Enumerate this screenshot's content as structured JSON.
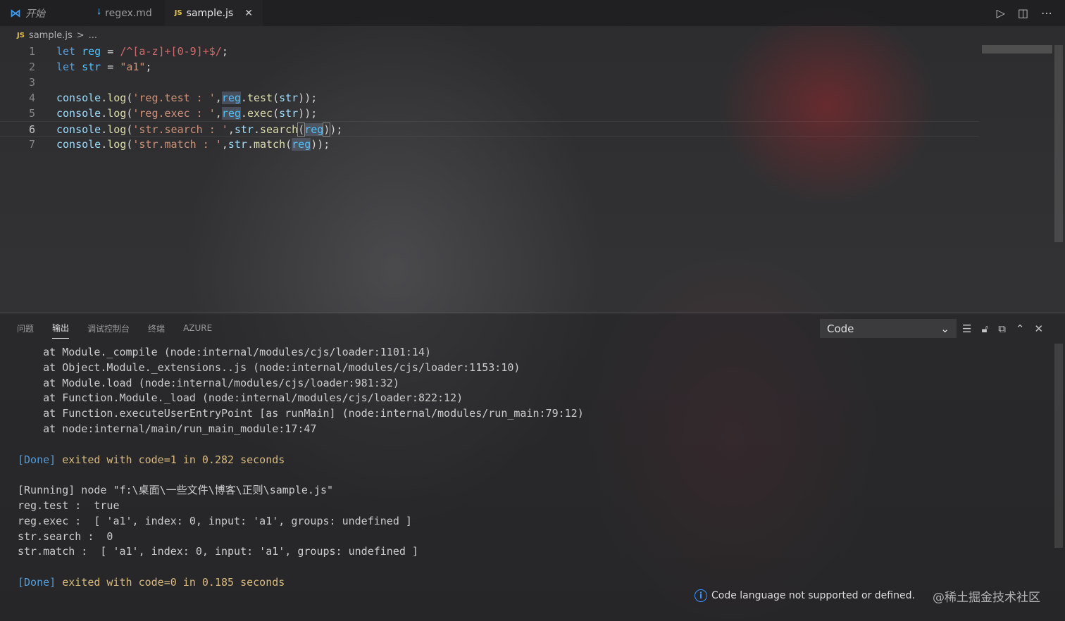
{
  "tabs": [
    {
      "label": "开始",
      "icon": "vscode-icon"
    },
    {
      "label": "regex.md",
      "icon": "markdown-icon"
    },
    {
      "label": "sample.js",
      "icon": "js-icon",
      "active": true,
      "close": "✕"
    }
  ],
  "breadcrumb": {
    "file": "sample.js",
    "sep": ">",
    "more": "..."
  },
  "editor": {
    "line_numbers": [
      "1",
      "2",
      "3",
      "4",
      "5",
      "6",
      "7"
    ],
    "lines": [
      [
        [
          "kw",
          "let "
        ],
        [
          "var",
          "reg"
        ],
        [
          "op",
          " = "
        ],
        [
          "rx",
          "/^[a-z]+[0-9]+$/"
        ],
        [
          "op",
          ";"
        ]
      ],
      [
        [
          "kw",
          "let "
        ],
        [
          "var",
          "str"
        ],
        [
          "op",
          " = "
        ],
        [
          "str",
          "\"a1\""
        ],
        [
          "op",
          ";"
        ]
      ],
      [],
      [
        [
          "obj",
          "console"
        ],
        [
          "op",
          "."
        ],
        [
          "fn",
          "log"
        ],
        [
          "op",
          "("
        ],
        [
          "str",
          "'reg.test : '"
        ],
        [
          "op",
          ","
        ],
        [
          "var hl",
          "reg"
        ],
        [
          "op",
          "."
        ],
        [
          "fn",
          "test"
        ],
        [
          "op",
          "("
        ],
        [
          "obj",
          "str"
        ],
        [
          "op",
          "));"
        ]
      ],
      [
        [
          "obj",
          "console"
        ],
        [
          "op",
          "."
        ],
        [
          "fn",
          "log"
        ],
        [
          "op",
          "("
        ],
        [
          "str",
          "'reg.exec : '"
        ],
        [
          "op",
          ","
        ],
        [
          "var hl",
          "reg"
        ],
        [
          "op",
          "."
        ],
        [
          "fn",
          "exec"
        ],
        [
          "op",
          "("
        ],
        [
          "obj",
          "str"
        ],
        [
          "op",
          "));"
        ]
      ],
      [
        [
          "obj",
          "console"
        ],
        [
          "op",
          "."
        ],
        [
          "fn",
          "log"
        ],
        [
          "op",
          "("
        ],
        [
          "str",
          "'str.search : '"
        ],
        [
          "op",
          ","
        ],
        [
          "obj",
          "str"
        ],
        [
          "op",
          "."
        ],
        [
          "fn",
          "search"
        ],
        [
          "op box",
          "("
        ],
        [
          "var hl",
          "reg"
        ],
        [
          "op box",
          ")"
        ],
        [
          "op",
          ");"
        ]
      ],
      [
        [
          "obj",
          "console"
        ],
        [
          "op",
          "."
        ],
        [
          "fn",
          "log"
        ],
        [
          "op",
          "("
        ],
        [
          "str",
          "'str.match : '"
        ],
        [
          "op",
          ","
        ],
        [
          "obj",
          "str"
        ],
        [
          "op",
          "."
        ],
        [
          "fn",
          "match"
        ],
        [
          "op",
          "("
        ],
        [
          "var hl",
          "reg"
        ],
        [
          "op",
          "));"
        ]
      ]
    ]
  },
  "panel": {
    "tabs": [
      "问题",
      "输出",
      "调试控制台",
      "终端",
      "AZURE"
    ],
    "active_tab": 1,
    "channel_select": "Code",
    "output_lines": [
      {
        "t": "    at Module._compile (node:internal/modules/cjs/loader:1101:14)"
      },
      {
        "t": "    at Object.Module._extensions..js (node:internal/modules/cjs/loader:1153:10)"
      },
      {
        "t": "    at Module.load (node:internal/modules/cjs/loader:981:32)"
      },
      {
        "t": "    at Function.Module._load (node:internal/modules/cjs/loader:822:12)"
      },
      {
        "t": "    at Function.executeUserEntryPoint [as runMain] (node:internal/modules/run_main:79:12)"
      },
      {
        "t": "    at node:internal/main/run_main_module:17:47"
      },
      {
        "t": ""
      },
      {
        "done": "[Done]",
        "t": " exited with code=1 in 0.282 seconds"
      },
      {
        "t": ""
      },
      {
        "t": "[Running] node \"f:\\桌面\\一些文件\\博客\\正则\\sample.js\""
      },
      {
        "t": "reg.test :  true"
      },
      {
        "t": "reg.exec :  [ 'a1', index: 0, input: 'a1', groups: undefined ]"
      },
      {
        "t": "str.search :  0"
      },
      {
        "t": "str.match :  [ 'a1', index: 0, input: 'a1', groups: undefined ]"
      },
      {
        "t": ""
      },
      {
        "done": "[Done]",
        "t": " exited with code=0 in 0.185 seconds"
      }
    ]
  },
  "notification": {
    "text": "Code language not supported or defined.",
    "icon": "info-icon"
  },
  "watermark": "@稀土掘金技术社区"
}
